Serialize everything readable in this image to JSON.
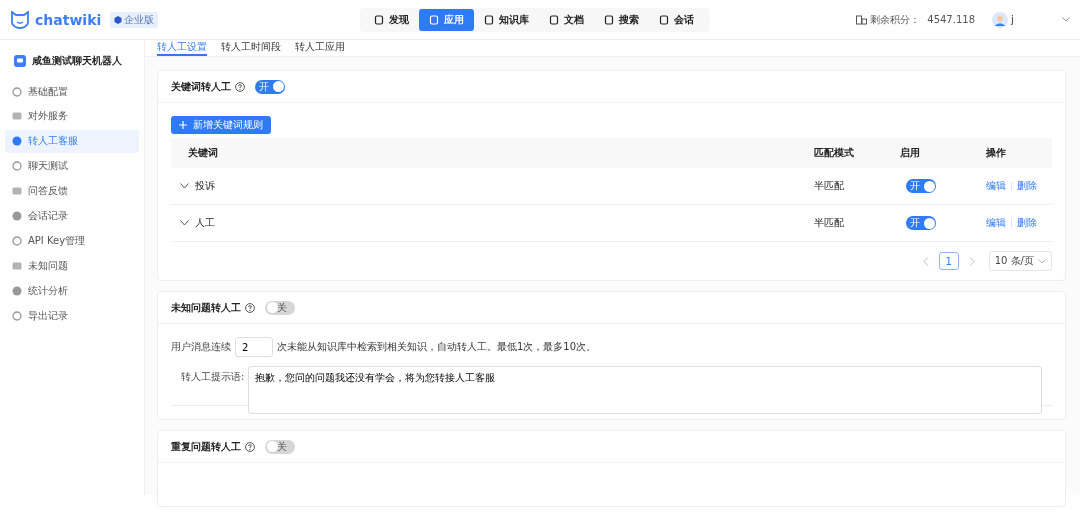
{
  "app": {
    "logo": "chatwiki",
    "edition": "企业版"
  },
  "nav": [
    {
      "label": "发现",
      "selected": false
    },
    {
      "label": "应用",
      "selected": true
    },
    {
      "label": "知识库",
      "selected": false
    },
    {
      "label": "文档",
      "selected": false
    },
    {
      "label": "搜索",
      "selected": false
    },
    {
      "label": "会话",
      "selected": false
    }
  ],
  "credits": {
    "label": "剩余积分：",
    "value": "4547.118"
  },
  "user": {
    "name": "j"
  },
  "robot": {
    "name": "咸鱼测试聊天机器人"
  },
  "sidebar": {
    "items": [
      {
        "label": "基础配置",
        "selected": false
      },
      {
        "label": "对外服务",
        "selected": false
      },
      {
        "label": "转人工客服",
        "selected": true
      },
      {
        "label": "聊天测试",
        "selected": false
      },
      {
        "label": "问答反馈",
        "selected": false
      },
      {
        "label": "会话记录",
        "selected": false
      },
      {
        "label": "API Key管理",
        "selected": false
      },
      {
        "label": "未知问题",
        "selected": false
      },
      {
        "label": "统计分析",
        "selected": false
      },
      {
        "label": "导出记录",
        "selected": false
      }
    ]
  },
  "tabs": [
    {
      "label": "转人工设置",
      "selected": true
    },
    {
      "label": "转人工时间段",
      "selected": false
    },
    {
      "label": "转人工应用",
      "selected": false
    }
  ],
  "sections": [
    {
      "kind": "keyword",
      "title": "关键词转人工",
      "enabled": true,
      "switch_label": "开",
      "add_button": "新增关键词规则",
      "columns": [
        "关键词",
        "匹配模式",
        "启用",
        "操作"
      ],
      "rows": [
        {
          "keyword": "投诉",
          "match": "半匹配",
          "enabled": true,
          "switch_label": "开",
          "actions": [
            "编辑",
            "删除"
          ]
        },
        {
          "keyword": "人工",
          "match": "半匹配",
          "enabled": true,
          "switch_label": "开",
          "actions": [
            "编辑",
            "删除"
          ]
        }
      ],
      "pages": [
        {
          "label": "1",
          "selected": true
        }
      ],
      "page_size": "10 条/页"
    },
    {
      "kind": "unknown",
      "title": "未知问题转人工",
      "enabled": false,
      "switch_label": "关",
      "count_label": "用户消息连续",
      "count_value": "2",
      "count_hint": "次未能从知识库中检索到相关知识，自动转人工。最低1次，最多10次。",
      "prompt_label": "转人工提示语:",
      "prompt_value": "抱歉，您问的问题我还没有学会，将为您转接人工客服"
    },
    {
      "kind": "repeat",
      "title": "重复问题转人工",
      "enabled": false,
      "switch_label": "关"
    }
  ]
}
